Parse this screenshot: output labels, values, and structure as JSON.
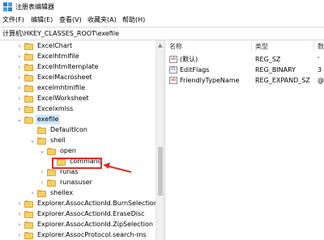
{
  "window": {
    "title": "注册表编辑器"
  },
  "menu": [
    "文件(F)",
    "编辑(E)",
    "查看(V)",
    "收藏夹(A)",
    "帮助(H)"
  ],
  "address": "计算机\\HKEY_CLASSES_ROOT\\exefile",
  "tree": [
    {
      "label": "ExcelChart",
      "level": 0,
      "expander": "right"
    },
    {
      "label": "Excelhtmlfile",
      "level": 0,
      "expander": "right"
    },
    {
      "label": "Excelhtmltemplate",
      "level": 0,
      "expander": "right"
    },
    {
      "label": "ExcelMacrosheet",
      "level": 0,
      "expander": "right"
    },
    {
      "label": "excelmhtmlfile",
      "level": 0,
      "expander": "right"
    },
    {
      "label": "ExcelWorksheet",
      "level": 0,
      "expander": "right"
    },
    {
      "label": "Excelxmlss",
      "level": 0,
      "expander": "right"
    },
    {
      "label": "exefile",
      "level": 0,
      "expander": "down",
      "selected": true
    },
    {
      "label": "DefaultIcon",
      "level": 1,
      "expander": ""
    },
    {
      "label": "shell",
      "level": 1,
      "expander": "down"
    },
    {
      "label": "open",
      "level": 2,
      "expander": "down"
    },
    {
      "label": "command",
      "level": 3,
      "expander": ""
    },
    {
      "label": "runas",
      "level": 2,
      "expander": "right"
    },
    {
      "label": "runasuser",
      "level": 2,
      "expander": "right"
    },
    {
      "label": "shellex",
      "level": 1,
      "expander": "right"
    },
    {
      "label": "Explorer.AssocActionId.BurnSelection",
      "level": 0,
      "expander": "right"
    },
    {
      "label": "Explorer.AssocActionId.EraseDisc",
      "level": 0,
      "expander": "right"
    },
    {
      "label": "Explorer.AssocActionId.ZipSelection",
      "level": 0,
      "expander": "right"
    },
    {
      "label": "Explorer.AssocProtocol.search-ms",
      "level": 0,
      "expander": "right"
    }
  ],
  "columns": {
    "name": "名称",
    "type": "类型",
    "data": "数"
  },
  "values": [
    {
      "name": "(默认)",
      "type": "REG_SZ",
      "data": "'",
      "icon": "ab",
      "icon_name": "string-value-icon"
    },
    {
      "name": "EditFlags",
      "type": "REG_BINARY",
      "data": "3",
      "icon": "01",
      "icon_name": "binary-value-icon"
    },
    {
      "name": "FriendlyTypeName",
      "type": "REG_EXPAND_SZ",
      "data": "@",
      "icon": "ab",
      "icon_name": "string-value-icon"
    }
  ],
  "colors": {
    "selection": "#cce8ff",
    "callout": "#d9302b",
    "folder": "#f5cf63"
  }
}
